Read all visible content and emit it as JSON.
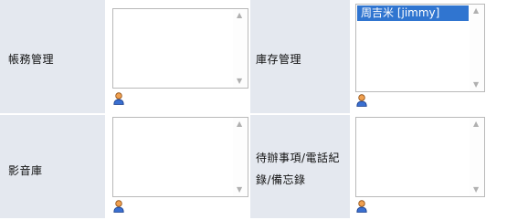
{
  "rows": [
    {
      "left_label": "帳務管理",
      "left_options": [],
      "right_label": "庫存管理",
      "right_options": [
        "周吉米 [jimmy]"
      ]
    },
    {
      "left_label": "影音庫",
      "left_options": [],
      "right_label_line1": "待辦事項/電話紀",
      "right_label_line2": "錄/備忘錄",
      "right_options": []
    }
  ],
  "icons": {
    "select_user": "person-icon",
    "scroll_up": "arrow-up-icon",
    "scroll_down": "arrow-down-icon"
  },
  "colors": {
    "label_bg": "#e4e8ef",
    "selected_bg": "#3075d0",
    "border": "#b9b9b9"
  }
}
